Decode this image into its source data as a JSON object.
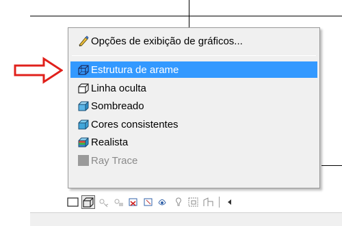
{
  "menu": {
    "items": [
      {
        "label": "Opções de exibição de gráficos...",
        "icon": "graphic-options-icon",
        "state": "normal"
      },
      {
        "label": "Estrutura de arame",
        "icon": "wireframe-cube-icon",
        "state": "selected"
      },
      {
        "label": "Linha oculta",
        "icon": "hidden-line-cube-icon",
        "state": "normal"
      },
      {
        "label": "Sombreado",
        "icon": "shaded-cube-icon",
        "state": "normal"
      },
      {
        "label": "Cores consistentes",
        "icon": "consistent-colors-cube-icon",
        "state": "normal"
      },
      {
        "label": "Realista",
        "icon": "realistic-cube-icon",
        "state": "normal"
      },
      {
        "label": "Ray Trace",
        "icon": "ray-trace-icon",
        "state": "disabled"
      }
    ]
  },
  "colors": {
    "selection": "#3399ff",
    "arrow": "#e0201b",
    "menu_bg": "#f0f0f0"
  },
  "toolbar": {
    "icons": [
      "detail-level-icon",
      "visual-style-icon",
      "sun-path-icon",
      "shadows-icon",
      "crop-region-icon",
      "show-crop-icon",
      "temporary-hide-icon",
      "reveal-elements-icon",
      "analysis-icon",
      "worksharing-icon"
    ]
  }
}
